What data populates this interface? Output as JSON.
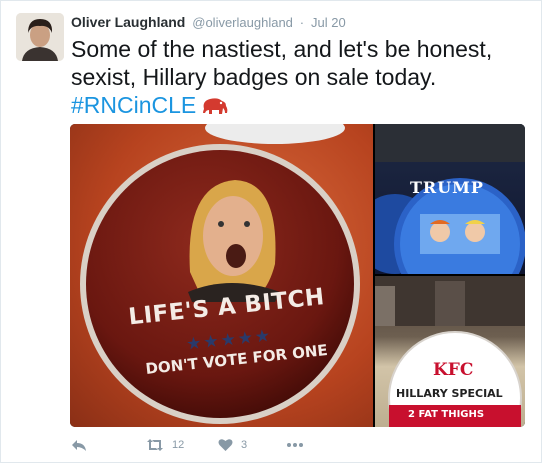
{
  "tweet": {
    "name": "Oliver Laughland",
    "handle": "@oliverlaughland",
    "separator": "·",
    "time": "Jul 20",
    "text_main": "Some of the nastiest, and let's be honest, sexist, Hillary badges on sale today.",
    "hashtag": "#RNCinCLE",
    "hashtag_emoji": "elephant-emoji"
  },
  "media": {
    "main_badge": {
      "line1": "LIFE'S A BITCH",
      "line2": "DON'T VOTE FOR ONE"
    },
    "top_right_badge": {
      "label": "TRUMP"
    },
    "bottom_right_badge": {
      "line1": "KFC",
      "line2": "HILLARY SPECIAL",
      "line3": "2 FAT THIGHS"
    }
  },
  "actions": {
    "retweet_count": "12",
    "like_count": "3",
    "icons": [
      "reply-icon",
      "retweet-icon",
      "like-icon",
      "more-icon"
    ]
  },
  "colors": {
    "link": "#1b95e0",
    "muted": "#8899a6",
    "badge_red": "#7a1a12"
  }
}
